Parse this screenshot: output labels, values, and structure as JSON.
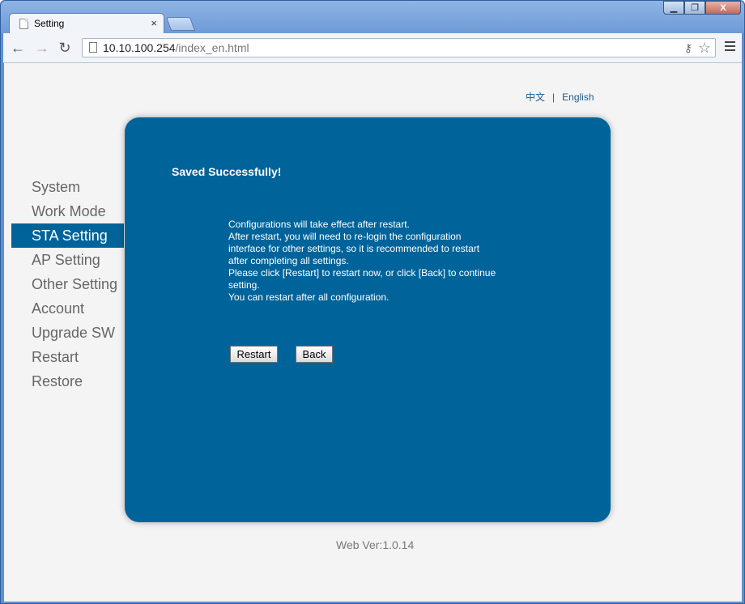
{
  "browser": {
    "tab_title": "Setting",
    "tab_close": "×",
    "url_host": "10.10.100.254",
    "url_path": "/index_en.html",
    "window_buttons": {
      "minimize": "▁",
      "maximize": "❐",
      "close": "X"
    }
  },
  "page": {
    "languages": [
      "中文",
      "English"
    ],
    "lang_separator": "|",
    "sidebar": {
      "items": [
        {
          "label": "System"
        },
        {
          "label": "Work Mode"
        },
        {
          "label": "STA Setting",
          "active": true
        },
        {
          "label": "AP Setting"
        },
        {
          "label": "Other Setting"
        },
        {
          "label": "Account"
        },
        {
          "label": "Upgrade SW"
        },
        {
          "label": "Restart"
        },
        {
          "label": "Restore"
        }
      ]
    },
    "panel": {
      "title": "Saved Successfully!",
      "message_lines": [
        "Configurations will take effect after restart.",
        "After restart, you will need to re-login the configuration",
        "interface for other settings, so it is recommended to restart",
        "after completing all settings.",
        "Please click [Restart] to restart now, or click [Back] to continue",
        "setting.",
        "You can restart after all configuration."
      ],
      "restart_label": "Restart",
      "back_label": "Back"
    },
    "footer": "Web Ver:1.0.14"
  },
  "colors": {
    "accent": "#00649a",
    "page_bg": "#f4f4f4",
    "sidebar_text": "#666666",
    "link": "#1a5c90"
  }
}
